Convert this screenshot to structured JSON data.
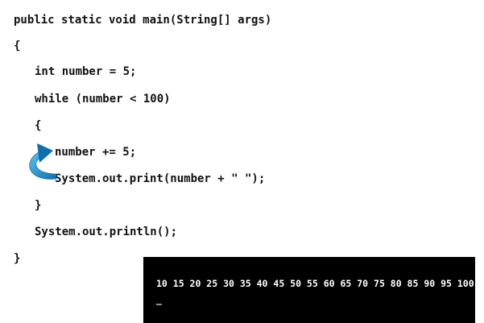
{
  "code": {
    "lines": [
      "public static void main(String[] args)",
      "{",
      "int number = 5;",
      "while (number < 100)",
      "{",
      "number += 5;",
      "System.out.print(number + \" \");",
      "}",
      "System.out.println();",
      "}"
    ]
  },
  "console": {
    "output": "10 15 20 25 30 35 40 45 50 55 60 65 70 75 80 85 90 95 100",
    "cursor": "_"
  },
  "colors": {
    "arrow_light": "#5cc4ef",
    "arrow_dark": "#0d6fae",
    "console_bg": "#000000"
  }
}
